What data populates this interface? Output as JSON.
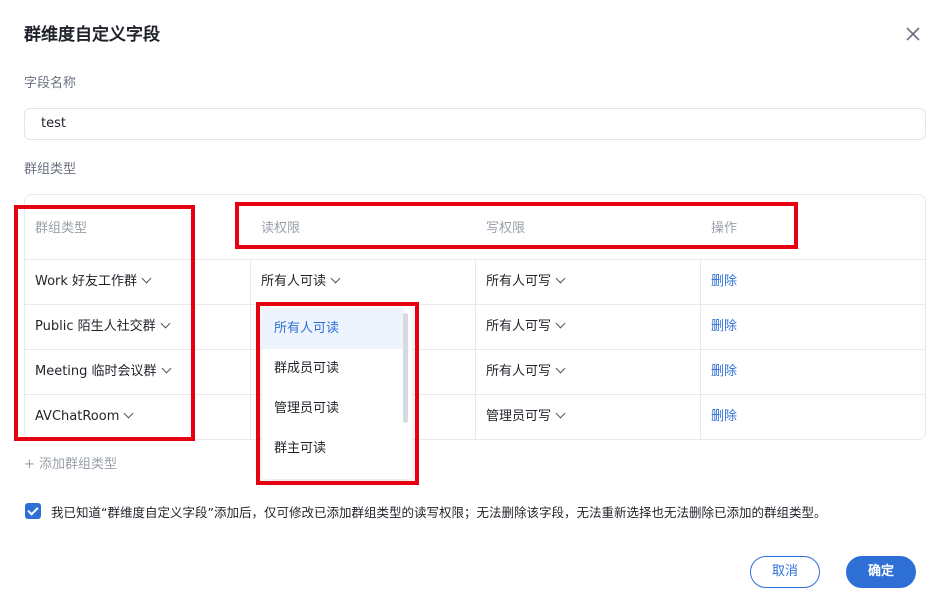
{
  "dialog": {
    "title": "群维度自定义字段"
  },
  "field_name": {
    "label": "字段名称",
    "value": "test"
  },
  "group_type_section": {
    "label": "群组类型"
  },
  "table": {
    "headers": {
      "group_type": "群组类型",
      "read": "读权限",
      "write": "写权限",
      "action": "操作"
    },
    "rows": [
      {
        "group_type": "Work 好友工作群",
        "read": "所有人可读",
        "write": "所有人可写",
        "action": "删除"
      },
      {
        "group_type": "Public 陌生人社交群",
        "read": "",
        "write": "所有人可写",
        "action": "删除"
      },
      {
        "group_type": "Meeting 临时会议群",
        "read": "",
        "write": "所有人可写",
        "action": "删除"
      },
      {
        "group_type": "AVChatRoom",
        "read": "",
        "write": "管理员可写",
        "action": "删除"
      }
    ]
  },
  "add_link": "+ 添加群组类型",
  "dropdown": {
    "options": [
      "所有人可读",
      "群成员可读",
      "管理员可读",
      "群主可读"
    ],
    "selected": "所有人可读"
  },
  "notice": {
    "checked": true,
    "text": "我已知道“群维度自定义字段”添加后，仅可修改已添加群组类型的读写权限；无法删除该字段，无法重新选择也无法删除已添加的群组类型。"
  },
  "buttons": {
    "cancel": "取消",
    "ok": "确定"
  },
  "colors": {
    "accent": "#2e6fd6",
    "highlight_box": "#e60012"
  }
}
